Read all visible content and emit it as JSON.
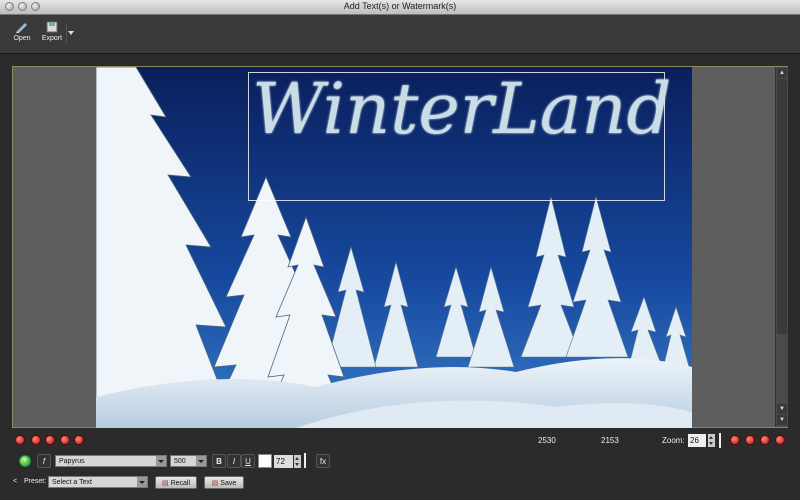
{
  "window": {
    "title": "Add Text(s) or Watermark(s)"
  },
  "toolbar": {
    "open_label": "Open",
    "export_label": "Export"
  },
  "canvas": {
    "watermark_text": "WinterLand"
  },
  "status": {
    "width_value": "2530",
    "height_value": "2153",
    "zoom_label": "Zoom:",
    "zoom_value": "26"
  },
  "text_controls": {
    "font_family": "Papyrus",
    "font_weight": "500",
    "bold_label": "B",
    "italic_label": "I",
    "underline_label": "U",
    "font_size": "72",
    "fx_label": "fx",
    "font_icon": "f",
    "text_color": "#ffffff"
  },
  "preset": {
    "label": "Preset:",
    "select_value": "Select a Text",
    "recall_label": "Recall",
    "save_label": "Save"
  },
  "icons": [
    "close-light",
    "minimize-light",
    "zoom-light",
    "open-icon",
    "export-icon",
    "chevron-down-icon",
    "add-text-icon",
    "align-icon",
    "rotate-icon"
  ],
  "colors": {
    "accent_red": "#c21b1b",
    "accent_green": "#2a9a10",
    "frame_border": "#8a8a5a",
    "background": "#2b2b2b"
  }
}
